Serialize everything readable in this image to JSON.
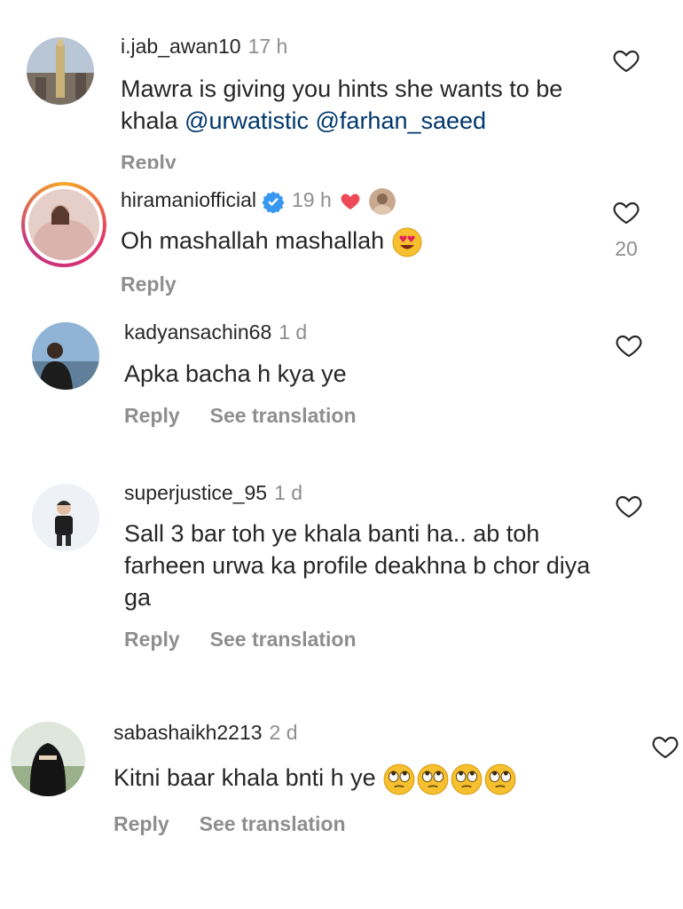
{
  "comments": [
    {
      "username": "i.jab_awan10",
      "time": "17 h",
      "text_parts": [
        "Mawra is giving you hints she wants to be khala ",
        "@urwatistic",
        " ",
        "@farhan_saeed"
      ],
      "reply": "Reply"
    },
    {
      "username": "hiramaniofficial",
      "time": "19 h",
      "text": "Oh mashallah mashallah",
      "reply": "Reply",
      "likes": "20"
    },
    {
      "username": "kadyansachin68",
      "time": "1 d",
      "text": "Apka bacha h kya ye",
      "reply": "Reply",
      "translate": "See translation"
    },
    {
      "username": "superjustice_95",
      "time": "1 d",
      "text": "Sall 3 bar toh ye khala banti ha.. ab toh farheen urwa ka profile deakhna b chor diya ga",
      "reply": "Reply",
      "translate": "See translation"
    },
    {
      "username": "sabashaikh2213",
      "time": "2 d",
      "text": "Kitni baar khala bnti h ye",
      "reply": "Reply",
      "translate": "See translation"
    }
  ],
  "colors": {
    "text": "#262626",
    "secondary": "#8e8e8e",
    "mention": "#00376b",
    "verified": "#3897f0",
    "red_heart": "#ed4956"
  },
  "icons": [
    "heart-outline-icon",
    "verified-badge-icon",
    "red-heart-emoji",
    "heart-eyes-emoji",
    "eye-roll-emoji"
  ]
}
